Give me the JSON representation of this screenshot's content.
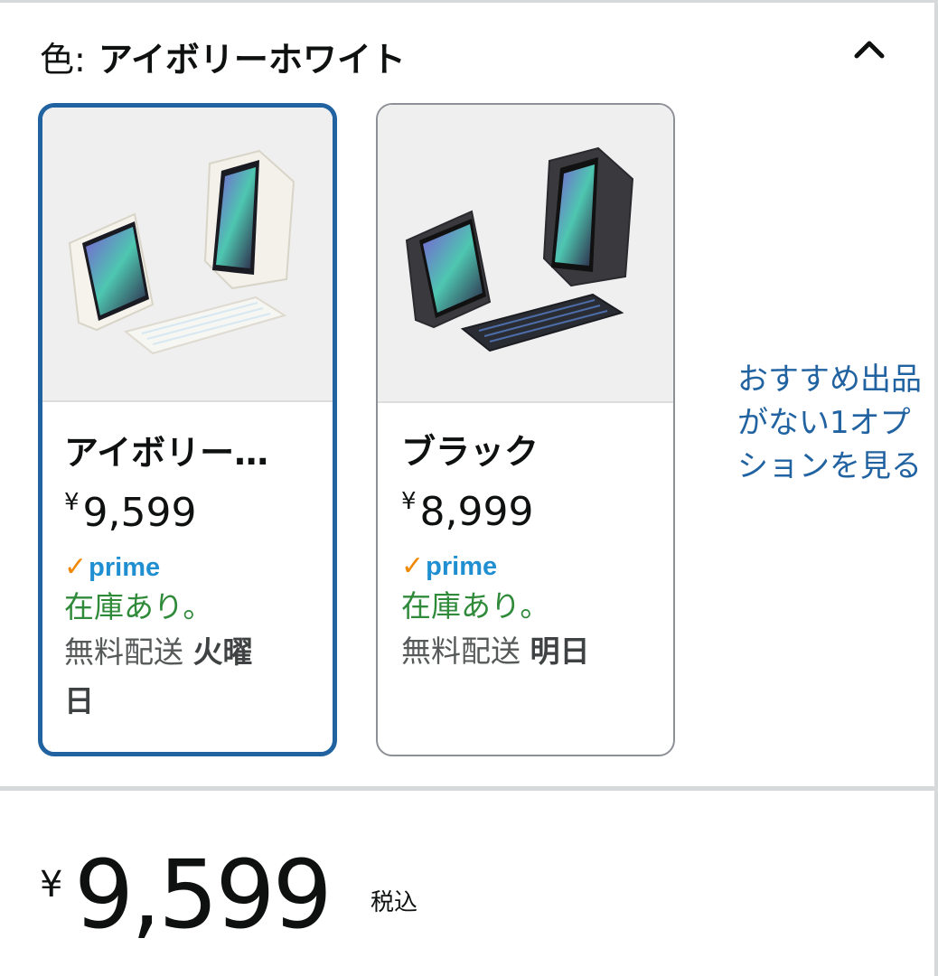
{
  "variation": {
    "label": "色:",
    "selected_value": "アイボリーホワイト",
    "collapse_icon": "chevron-up-icon"
  },
  "swatches": [
    {
      "name": "アイボリー…",
      "currency": "¥",
      "price": "9,599",
      "prime": "prime",
      "stock": "在庫あり。",
      "shipping_label": "無料配送",
      "shipping_day_line1": "火曜",
      "shipping_day_line2": "日",
      "selected": true,
      "image_icon": "ipad-keyboard-case-ivory-image"
    },
    {
      "name": "ブラック",
      "currency": "¥",
      "price": "8,999",
      "prime": "prime",
      "stock": "在庫あり。",
      "shipping_label": "無料配送",
      "shipping_day": "明日",
      "selected": false,
      "image_icon": "ipad-keyboard-case-black-image"
    }
  ],
  "more_options": {
    "line1": "おすすめ出品",
    "line2": "がない1オプ",
    "line3": "ションを見る"
  },
  "price_block": {
    "currency": "¥",
    "amount": "9,599",
    "tax_note": "税込"
  },
  "colors": {
    "selected_border": "#2162a1",
    "stock_green": "#2f8a39",
    "prime_blue": "#1f8fd2",
    "prime_check": "#f08804",
    "link_blue": "#2162a1"
  }
}
